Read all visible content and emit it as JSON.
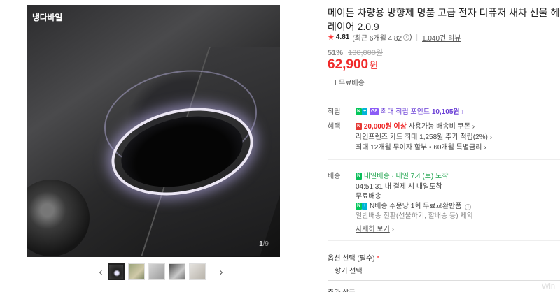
{
  "gallery": {
    "brand": "냉다바일",
    "pager_current": "1",
    "pager_total": "/9",
    "prev_icon": "chevron-left-icon",
    "next_icon": "chevron-right-icon",
    "thumb_count": 5
  },
  "product": {
    "title_line1": "메이튼 차량용 방향제 명품 고급 전자 디퓨저 새차 선물 헤일로",
    "title_line2": "레이어 2.0.9",
    "rating_score": "4.81",
    "rating_recent": "(최근 6개월 4.82",
    "rating_recent_close": ")",
    "reviews": "1,040건 리뷰",
    "discount_pct": "51%",
    "original_price": "130,000원",
    "price": "62,900",
    "price_unit": "원",
    "shipping_free": "무료배송"
  },
  "points": {
    "label": "적립",
    "badge_n": "N",
    "badge_plus": "+",
    "badge_card": "G8",
    "text_prefix": "최대 적립 포인트 ",
    "amount": "10,105원",
    "chevron": "›"
  },
  "benefits": {
    "label": "혜택",
    "badge": "N",
    "line1_red": "20,000원 이상",
    "line1_rest": " 사용가능 배송비 쿠폰",
    "line2": "라인프렌즈 카드 최대 1,258원 추가 적립(2%)",
    "line3": "최대 12개월 무이자 할부 • 60개월 특별금리",
    "chevron": "›"
  },
  "delivery": {
    "label": "배송",
    "tomorrow_badge": "N",
    "tomorrow_text": "내일배송",
    "tomorrow_date": " · 내일 7.4 (토) 도착",
    "deadline": "04:51:31  내 결제 시 내일도착",
    "free": "무료배송",
    "exchange_prefix": "N배송 주문당 1회 무료교환반품",
    "normal": "일반배송 전환(선물하기, 할배송 등) 제외",
    "detail_link": "자세히 보기"
  },
  "options": {
    "label": "옵션 선택 (필수)",
    "required_mark": "*",
    "select_placeholder": "향기 선택",
    "label2": "추가 상품",
    "watermark": "Win"
  }
}
